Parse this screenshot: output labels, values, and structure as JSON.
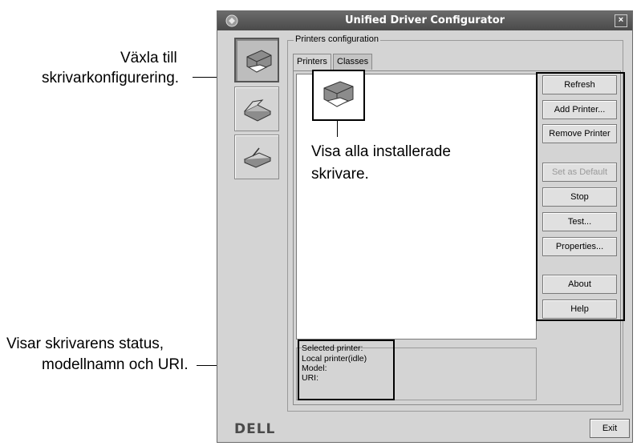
{
  "callouts": {
    "switch_line1": "Växla till",
    "switch_line2": "skrivarkonfigurering.",
    "status_line1": "Visar skrivarens status,",
    "status_line2": "modellnamn och URI.",
    "installed_line1": "Visa alla installerade",
    "installed_line2": "skrivare."
  },
  "window": {
    "title": "Unified Driver Configurator",
    "close_glyph": "×"
  },
  "sidebar": {
    "items": [
      {
        "name": "printers-config",
        "icon": "printer-icon"
      },
      {
        "name": "scanners-config",
        "icon": "scanner-icon"
      },
      {
        "name": "ports-config",
        "icon": "port-icon"
      }
    ]
  },
  "group": {
    "legend": "Printers configuration"
  },
  "tabs": [
    {
      "label": "Printers"
    },
    {
      "label": "Classes"
    }
  ],
  "buttons": {
    "refresh": "Refresh",
    "add_printer": "Add Printer...",
    "remove_printer": "Remove Printer",
    "set_default": "Set as Default",
    "stop": "Stop",
    "test": "Test...",
    "properties": "Properties...",
    "about": "About",
    "help": "Help"
  },
  "status": {
    "legend": "Selected printer:",
    "line1": "Local printer(idle)",
    "line2": "Model:",
    "line3": "URI:"
  },
  "footer": {
    "logo": "DELL",
    "exit": "Exit"
  }
}
